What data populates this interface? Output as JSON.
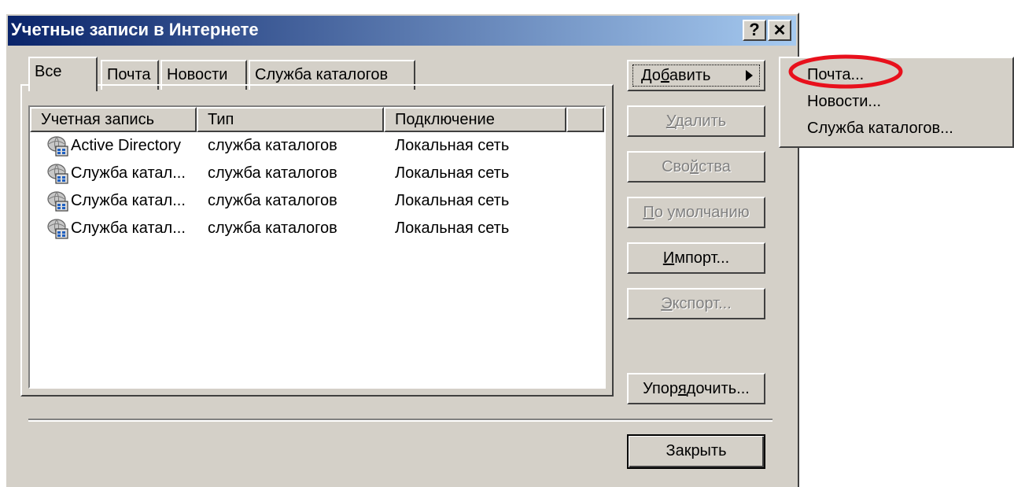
{
  "window": {
    "title": "Учетные записи в Интернете",
    "help_label": "?",
    "close_label": "✕"
  },
  "tabs": [
    {
      "label": "Все",
      "active": true
    },
    {
      "label": "Почта"
    },
    {
      "label": "Новости"
    },
    {
      "label": "Служба каталогов"
    }
  ],
  "list": {
    "columns": [
      "Учетная запись",
      "Тип",
      "Подключение",
      ""
    ],
    "rows": [
      {
        "account": "Active Directory",
        "type": "служба каталогов",
        "connection": "Локальная сеть",
        "icon": "directory-service-icon"
      },
      {
        "account": "Служба катал...",
        "type": "служба каталогов",
        "connection": "Локальная сеть",
        "icon": "directory-service-icon"
      },
      {
        "account": "Служба катал...",
        "type": "служба каталогов",
        "connection": "Локальная сеть",
        "icon": "directory-service-icon"
      },
      {
        "account": "Служба катал...",
        "type": "служба каталогов",
        "connection": "Локальная сеть",
        "icon": "directory-service-icon"
      }
    ]
  },
  "buttons": {
    "add": {
      "prefix": "До",
      "mnemonic": "б",
      "suffix": "авить"
    },
    "delete": {
      "prefix": "",
      "mnemonic": "У",
      "suffix": "далить",
      "disabled": true
    },
    "properties": {
      "prefix": "Сво",
      "mnemonic": "й",
      "suffix": "ства",
      "disabled": true
    },
    "default": {
      "prefix": "",
      "mnemonic": "П",
      "suffix": "о умолчанию",
      "disabled": true
    },
    "import": {
      "prefix": "",
      "mnemonic": "И",
      "suffix": "мпорт...",
      "disabled": false
    },
    "export": {
      "prefix": "",
      "mnemonic": "Э",
      "suffix": "кспорт...",
      "disabled": true
    },
    "arrange": {
      "prefix": "Упор",
      "mnemonic": "я",
      "suffix": "дочить..."
    },
    "close": {
      "label": "Закрыть"
    }
  },
  "add_menu": {
    "items": [
      "Почта...",
      "Новости...",
      "Служба каталогов..."
    ],
    "highlighted_item": "Почта...",
    "highlight_color": "#e8101c"
  },
  "colors": {
    "titlebar_start": "#0a246a",
    "titlebar_end": "#a6caf0",
    "face": "#d4d0c8"
  }
}
